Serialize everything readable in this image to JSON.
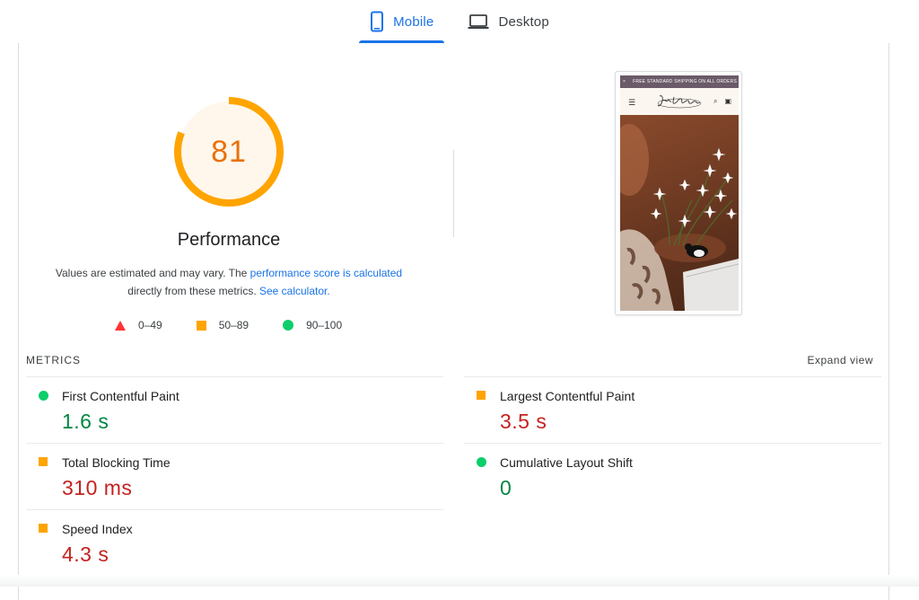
{
  "tabs": [
    {
      "label": "Mobile",
      "icon": "mobile-icon",
      "active": true
    },
    {
      "label": "Desktop",
      "icon": "desktop-icon",
      "active": false
    }
  ],
  "gauge": {
    "score": "81",
    "score_value": 81,
    "color": "#ffa400",
    "text_color": "#e8710a",
    "fill_color": "#fff7ec"
  },
  "performance": {
    "title": "Performance",
    "desc_prefix": "Values are estimated and may vary. The ",
    "desc_link1": "performance score is calculated",
    "desc_mid": " directly from these metrics. ",
    "desc_link2": "See calculator."
  },
  "legend": [
    {
      "range": "0–49",
      "shape": "triangle",
      "color": "#ff3333"
    },
    {
      "range": "50–89",
      "shape": "square",
      "color": "#ffa400"
    },
    {
      "range": "90–100",
      "shape": "circle",
      "color": "#0cce6b"
    }
  ],
  "screenshot": {
    "promo_text": "FREE STANDARD SHIPPING ON ALL ORDERS",
    "logo_text": "Jodi Avalon"
  },
  "metrics": {
    "heading": "METRICS",
    "expand_label": "Expand view",
    "items": [
      {
        "label": "First Contentful Paint",
        "value": "1.6 s",
        "status": "green"
      },
      {
        "label": "Largest Contentful Paint",
        "value": "3.5 s",
        "status": "orange"
      },
      {
        "label": "Total Blocking Time",
        "value": "310 ms",
        "status": "orange"
      },
      {
        "label": "Cumulative Layout Shift",
        "value": "0",
        "status": "green"
      },
      {
        "label": "Speed Index",
        "value": "4.3 s",
        "status": "orange"
      }
    ]
  }
}
